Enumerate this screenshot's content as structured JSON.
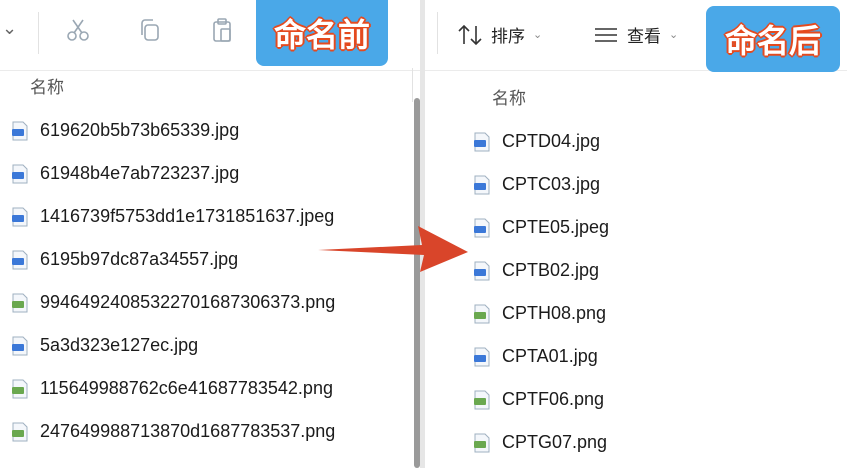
{
  "left_panel": {
    "badge": "命名前",
    "toolbar_more_chevron": "⌄",
    "column_header": "名称",
    "files": [
      {
        "name": "619620b5b73b65339.jpg",
        "type": "jpg"
      },
      {
        "name": "61948b4e7ab723237.jpg",
        "type": "jpg"
      },
      {
        "name": "1416739f5753dd1e1731851637.jpeg",
        "type": "jpg"
      },
      {
        "name": "6195b97dc87a34557.jpg",
        "type": "jpg"
      },
      {
        "name": "99464924085322701687306373.png",
        "type": "png"
      },
      {
        "name": "5a3d323e127ec.jpg",
        "type": "jpg"
      },
      {
        "name": "115649988762c6e41687783542.png",
        "type": "png"
      },
      {
        "name": "247649988713870d1687783537.png",
        "type": "png"
      }
    ]
  },
  "right_panel": {
    "badge": "命名后",
    "sort_label": "排序",
    "view_label": "查看",
    "column_header": "名称",
    "files": [
      {
        "name": "CPTD04.jpg",
        "type": "jpg"
      },
      {
        "name": "CPTC03.jpg",
        "type": "jpg"
      },
      {
        "name": "CPTE05.jpeg",
        "type": "jpg"
      },
      {
        "name": "CPTB02.jpg",
        "type": "jpg"
      },
      {
        "name": "CPTH08.png",
        "type": "png"
      },
      {
        "name": "CPTA01.jpg",
        "type": "jpg"
      },
      {
        "name": "CPTF06.png",
        "type": "png"
      },
      {
        "name": "CPTG07.png",
        "type": "png"
      }
    ]
  },
  "colors": {
    "badge_bg": "#4aa8e8",
    "badge_outline": "#e44a1f",
    "arrow": "#d9452a",
    "jpg_icon": "#3b78d8",
    "png_icon": "#6aa84f"
  },
  "icons": {
    "cut": "scissors-icon",
    "copy": "copy-icon",
    "paste": "paste-icon",
    "sort": "sort-arrows-icon",
    "view": "view-lines-icon",
    "arrow": "right-arrow-icon"
  }
}
